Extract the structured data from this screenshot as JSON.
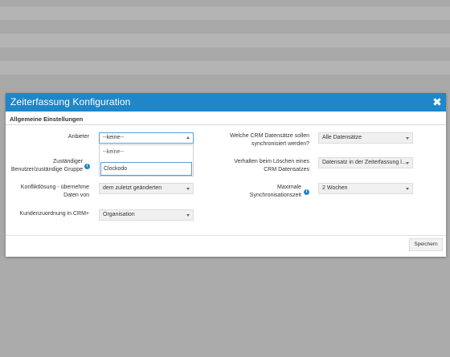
{
  "modal": {
    "title": "Zeiterfassung Konfiguration",
    "close_icon": "close-icon",
    "section": "Allgemeine Einstellungen",
    "accent_color": "#1e87c9"
  },
  "left": {
    "anbieter_label": "Anbieter",
    "anbieter_value": "--keine--",
    "anbieter_options": [
      "--keine--"
    ],
    "anbieter_search": "Clockodo",
    "zustaendig_label_1": "Zuständiger",
    "zustaendig_label_2": "Benutzer/zuständige Gruppe",
    "konflikt_label_1": "Konfliktlösung - übernehme",
    "konflikt_label_2": "Daten von",
    "konflikt_value": "dem zuletzt geänderten",
    "kunden_label": "Kundenzuordnung in CRM+",
    "kunden_value": "Organisation"
  },
  "right": {
    "welche_label_1": "Welche CRM Datensätze sollen",
    "welche_label_2": "synchronisiert werden?",
    "welche_value": "Alle Datensätze",
    "verhalten_label_1": "Verhalten beim Löschen eines",
    "verhalten_label_2": "CRM Datensatzes",
    "verhalten_value": "Datensatz in der Zeiterfassung l...",
    "maximale_label_1": "Maximale",
    "maximale_label_2": "Synchronisationszeit",
    "maximale_value": "2 Wochen"
  },
  "footer": {
    "save_label": "Speichern"
  }
}
